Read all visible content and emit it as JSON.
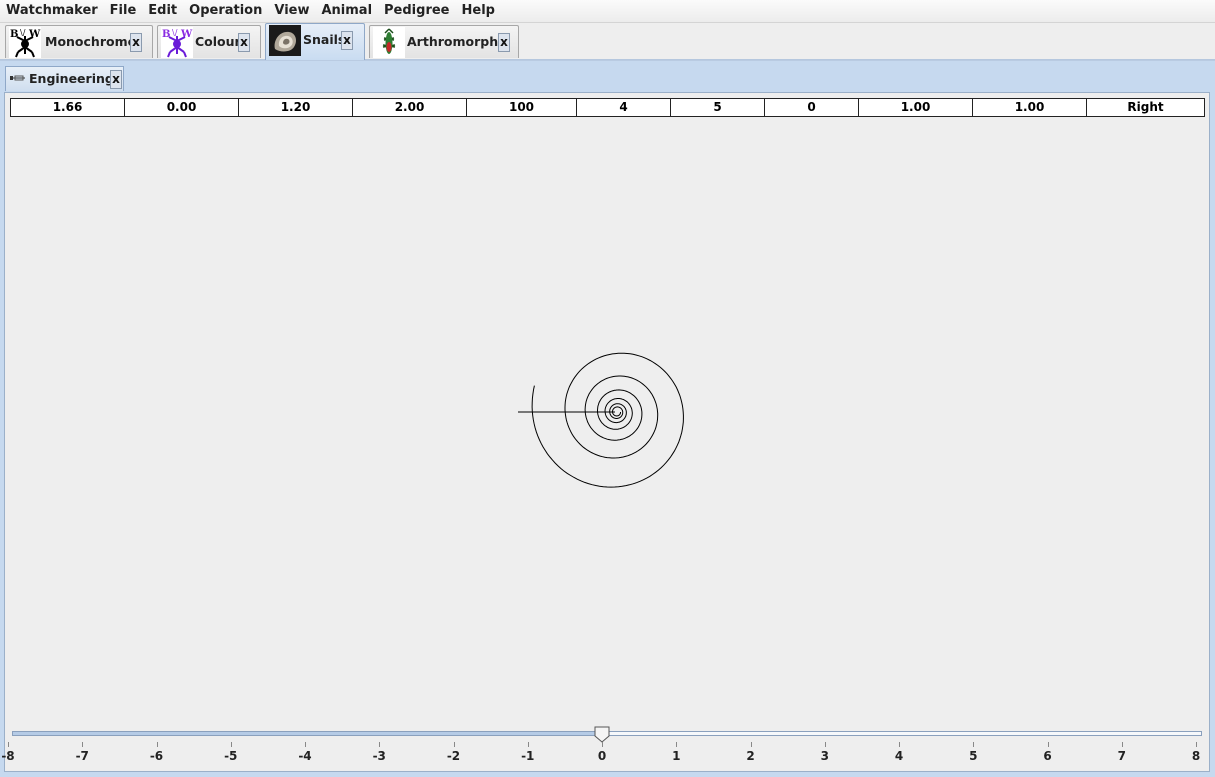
{
  "menu": [
    "Watchmaker",
    "File",
    "Edit",
    "Operation",
    "View",
    "Animal",
    "Pedigree",
    "Help"
  ],
  "tabs": [
    {
      "label": "Monochrome",
      "close": "x",
      "icon": "monochrome-biomorph-icon"
    },
    {
      "label": "Colour",
      "close": "x",
      "icon": "colour-biomorph-icon"
    },
    {
      "label": "Snails",
      "close": "x",
      "icon": "snail-shell-icon",
      "selected": true
    },
    {
      "label": "Arthromorphs",
      "close": "x",
      "icon": "arthromorph-icon"
    }
  ],
  "subtab": {
    "label": "Engineering",
    "close": "x",
    "icon": "engineering-icon"
  },
  "genome": [
    "1.66",
    "0.00",
    "1.20",
    "2.00",
    "100",
    "4",
    "5",
    "0",
    "1.00",
    "1.00",
    "Right"
  ],
  "slider": {
    "min": -8,
    "max": 8,
    "value": 0,
    "ticks": [
      "-8",
      "-7",
      "-6",
      "-5",
      "-4",
      "-3",
      "-2",
      "-1",
      "0",
      "1",
      "2",
      "3",
      "4",
      "5",
      "6",
      "7",
      "8"
    ]
  },
  "colors": {
    "accent": "#c6d9ef",
    "background": "#eeeeee",
    "shell_stroke": "#000000"
  }
}
